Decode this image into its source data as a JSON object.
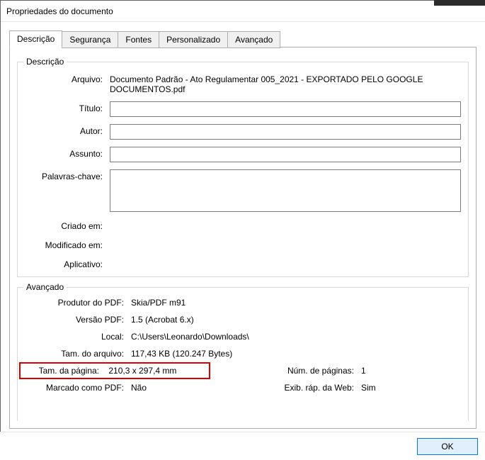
{
  "window": {
    "title": "Propriedades do documento"
  },
  "tabs": {
    "items": [
      {
        "label": "Descrição"
      },
      {
        "label": "Segurança"
      },
      {
        "label": "Fontes"
      },
      {
        "label": "Personalizado"
      },
      {
        "label": "Avançado"
      }
    ]
  },
  "description_group": {
    "title": "Descrição",
    "file_label": "Arquivo:",
    "file_value": "Documento Padrão - Ato Regulamentar 005_2021 - EXPORTADO PELO GOOGLE DOCUMENTOS.pdf",
    "title_label": "Título:",
    "title_value": "",
    "author_label": "Autor:",
    "author_value": "",
    "subject_label": "Assunto:",
    "subject_value": "",
    "keywords_label": "Palavras-chave:",
    "keywords_value": "",
    "created_label": "Criado em:",
    "created_value": "",
    "modified_label": "Modificado em:",
    "modified_value": "",
    "app_label": "Aplicativo:",
    "app_value": ""
  },
  "advanced_group": {
    "title": "Avançado",
    "producer_label": "Produtor do PDF:",
    "producer_value": "Skia/PDF m91",
    "version_label": "Versão PDF:",
    "version_value": "1.5 (Acrobat 6.x)",
    "location_label": "Local:",
    "location_value": "C:\\Users\\Leonardo\\Downloads\\",
    "filesize_label": "Tam. do arquivo:",
    "filesize_value": "117,43 KB (120.247 Bytes)",
    "pagesize_label": "Tam. da página:",
    "pagesize_value": "210,3 x 297,4 mm",
    "pagecount_label": "Núm. de páginas:",
    "pagecount_value": "1",
    "tagged_label": "Marcado como PDF:",
    "tagged_value": "Não",
    "fastweb_label": "Exib. ráp. da Web:",
    "fastweb_value": "Sim"
  },
  "buttons": {
    "ok": "OK"
  }
}
